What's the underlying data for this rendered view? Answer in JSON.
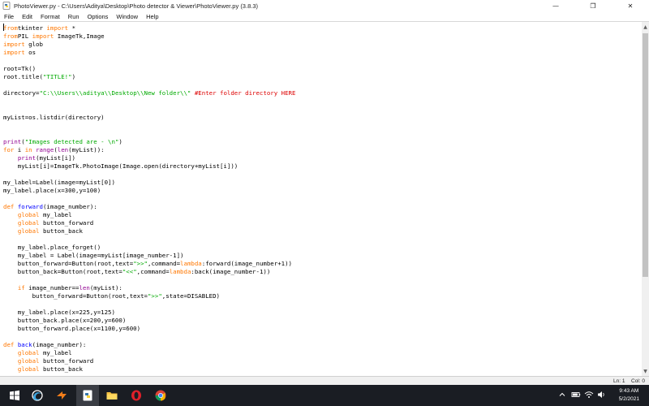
{
  "window": {
    "title": "PhotoViewer.py - C:\\Users\\Aditya\\Desktop\\Photo detector  & Viewer\\PhotoViewer.py (3.8.3)",
    "minimize": "—",
    "maximize": "❐",
    "close": "✕"
  },
  "menu": [
    "File",
    "Edit",
    "Format",
    "Run",
    "Options",
    "Window",
    "Help"
  ],
  "code_lines": [
    [
      [
        "kw",
        "from"
      ],
      [
        "",
        "tkinter "
      ],
      [
        "kw",
        "import"
      ],
      [
        "",
        " *"
      ]
    ],
    [
      [
        "kw",
        "from"
      ],
      [
        "",
        "PIL "
      ],
      [
        "kw",
        "import"
      ],
      [
        "",
        " ImageTk,Image"
      ]
    ],
    [
      [
        "kw",
        "import"
      ],
      [
        "",
        " glob"
      ]
    ],
    [
      [
        "kw",
        "import"
      ],
      [
        "",
        " os"
      ]
    ],
    [],
    [
      [
        "",
        "root=Tk()"
      ]
    ],
    [
      [
        "",
        "root.title("
      ],
      [
        "st",
        "\"TITLE!\""
      ],
      [
        "",
        ")"
      ]
    ],
    [],
    [
      [
        "",
        "directory="
      ],
      [
        "st",
        "\"C:\\\\Users\\\\aditya\\\\Desktop\\\\New folder\\\\\""
      ],
      [
        "",
        " "
      ],
      [
        "cm",
        "#Enter folder directory HERE"
      ]
    ],
    [],
    [],
    [
      [
        "",
        "myList=os.listdir(directory)"
      ]
    ],
    [],
    [],
    [
      [
        "bi",
        "print"
      ],
      [
        "",
        "("
      ],
      [
        "st",
        "\"Images detected are - \\n\""
      ],
      [
        "",
        ")"
      ]
    ],
    [
      [
        "kw",
        "for"
      ],
      [
        "",
        " i "
      ],
      [
        "kw",
        "in"
      ],
      [
        "",
        " "
      ],
      [
        "bi",
        "range"
      ],
      [
        "",
        "("
      ],
      [
        "bi",
        "len"
      ],
      [
        "",
        "(myList)):"
      ]
    ],
    [
      [
        "",
        "    "
      ],
      [
        "bi",
        "print"
      ],
      [
        "",
        "(myList[i])"
      ]
    ],
    [
      [
        "",
        "    myList[i]=ImageTk.PhotoImage(Image.open(directory+myList[i]))"
      ]
    ],
    [],
    [
      [
        "",
        "my_label=Label(image=myList[0])"
      ]
    ],
    [
      [
        "",
        "my_label.place(x=300,y=100)"
      ]
    ],
    [],
    [
      [
        "kw",
        "def"
      ],
      [
        "",
        " "
      ],
      [
        "df",
        "forward"
      ],
      [
        "",
        "(image_number):"
      ]
    ],
    [
      [
        "",
        "    "
      ],
      [
        "kw",
        "global"
      ],
      [
        "",
        " my_label"
      ]
    ],
    [
      [
        "",
        "    "
      ],
      [
        "kw",
        "global"
      ],
      [
        "",
        " button_forward"
      ]
    ],
    [
      [
        "",
        "    "
      ],
      [
        "kw",
        "global"
      ],
      [
        "",
        " button_back"
      ]
    ],
    [],
    [
      [
        "",
        "    my_label.place_forget()"
      ]
    ],
    [
      [
        "",
        "    my_label = Label(image=myList[image_number-1])"
      ]
    ],
    [
      [
        "",
        "    button_forward=Button(root,text="
      ],
      [
        "st",
        "\">>\""
      ],
      [
        "",
        ",command="
      ],
      [
        "kw",
        "lambda"
      ],
      [
        "",
        ":forward(image_number+1))"
      ]
    ],
    [
      [
        "",
        "    button_back=Button(root,text="
      ],
      [
        "st",
        "\"<<\""
      ],
      [
        "",
        ",command="
      ],
      [
        "kw",
        "lambda"
      ],
      [
        "",
        ":back(image_number-1))"
      ]
    ],
    [],
    [
      [
        "",
        "    "
      ],
      [
        "kw",
        "if"
      ],
      [
        "",
        " image_number=="
      ],
      [
        "bi",
        "len"
      ],
      [
        "",
        "(myList):"
      ]
    ],
    [
      [
        "",
        "        button_forward=Button(root,text="
      ],
      [
        "st",
        "\">>\""
      ],
      [
        "",
        ",state=DISABLED)"
      ]
    ],
    [],
    [
      [
        "",
        "    my_label.place(x=225,y=125)"
      ]
    ],
    [
      [
        "",
        "    button_back.place(x=200,y=600)"
      ]
    ],
    [
      [
        "",
        "    button_forward.place(x=1100,y=600)"
      ]
    ],
    [],
    [
      [
        "kw",
        "def"
      ],
      [
        "",
        " "
      ],
      [
        "df",
        "back"
      ],
      [
        "",
        "(image_number):"
      ]
    ],
    [
      [
        "",
        "    "
      ],
      [
        "kw",
        "global"
      ],
      [
        "",
        " my_label"
      ]
    ],
    [
      [
        "",
        "    "
      ],
      [
        "kw",
        "global"
      ],
      [
        "",
        " button_forward"
      ]
    ],
    [
      [
        "",
        "    "
      ],
      [
        "kw",
        "global"
      ],
      [
        "",
        " button_back"
      ]
    ]
  ],
  "colors": {
    "keyword": "#ff7700",
    "builtin": "#900090",
    "string": "#00aa00",
    "comment": "#dd0000",
    "definition": "#0000ff"
  },
  "status": {
    "line": "Ln: 1",
    "col": "Col: 0"
  },
  "clock": {
    "time": "9:43 AM",
    "date": "5/2/2021"
  },
  "taskbar_icons": [
    "windows-start-icon",
    "search-icon",
    "edge-icon",
    "cortana-icon",
    "blender-icon",
    "idle-python-icon",
    "file-explorer-icon",
    "opera-icon",
    "chrome-icon"
  ]
}
